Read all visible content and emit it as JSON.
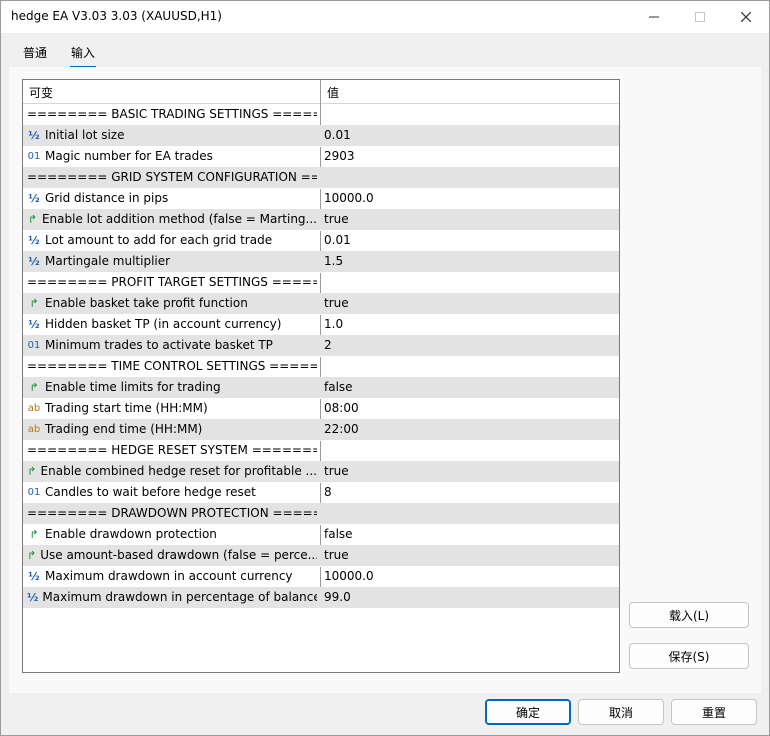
{
  "window": {
    "title": "hedge EA V3.03 3.03 (XAUUSD,H1)"
  },
  "tabs": [
    {
      "label": "普通"
    },
    {
      "label": "输入"
    }
  ],
  "grid": {
    "headers": {
      "variable": "可变",
      "value": "值"
    },
    "rows": [
      {
        "type": "section",
        "name": "======== BASIC TRADING SETTINGS ========",
        "value": ""
      },
      {
        "type": "double",
        "icon": "double-icon",
        "name": "Initial lot size",
        "value": "0.01"
      },
      {
        "type": "int",
        "icon": "integer-icon",
        "name": "Magic number for EA trades",
        "value": "2903"
      },
      {
        "type": "section",
        "name": "======== GRID SYSTEM CONFIGURATION ==...",
        "value": ""
      },
      {
        "type": "double",
        "icon": "double-icon",
        "name": "Grid distance in pips",
        "value": "10000.0"
      },
      {
        "type": "bool",
        "icon": "boolean-icon",
        "name": "Enable lot addition method (false = Marting...",
        "value": "true"
      },
      {
        "type": "double",
        "icon": "double-icon",
        "name": "Lot amount to add for each grid trade",
        "value": "0.01"
      },
      {
        "type": "double",
        "icon": "double-icon",
        "name": "Martingale multiplier",
        "value": "1.5"
      },
      {
        "type": "section",
        "name": "======== PROFIT TARGET SETTINGS ========",
        "value": ""
      },
      {
        "type": "bool",
        "icon": "boolean-icon",
        "name": "Enable basket take profit function",
        "value": "true"
      },
      {
        "type": "double",
        "icon": "double-icon",
        "name": "Hidden basket TP  (in account currency)",
        "value": "1.0"
      },
      {
        "type": "int",
        "icon": "integer-icon",
        "name": "Minimum trades to activate basket TP",
        "value": "2"
      },
      {
        "type": "section",
        "name": "======== TIME CONTROL SETTINGS ========",
        "value": ""
      },
      {
        "type": "bool",
        "icon": "boolean-icon",
        "name": "Enable time limits for trading",
        "value": "false"
      },
      {
        "type": "string",
        "icon": "string-icon",
        "name": "Trading start time (HH:MM)",
        "value": "08:00"
      },
      {
        "type": "string",
        "icon": "string-icon",
        "name": "Trading end time (HH:MM)",
        "value": "22:00"
      },
      {
        "type": "section",
        "name": "======== HEDGE RESET SYSTEM ========",
        "value": ""
      },
      {
        "type": "bool",
        "icon": "boolean-icon",
        "name": "Enable combined hedge reset for profitable ...",
        "value": "true"
      },
      {
        "type": "int",
        "icon": "integer-icon",
        "name": "Candles to wait before hedge reset",
        "value": "8"
      },
      {
        "type": "section",
        "name": "======== DRAWDOWN PROTECTION ======...",
        "value": ""
      },
      {
        "type": "bool",
        "icon": "boolean-icon",
        "name": "Enable drawdown protection",
        "value": "false"
      },
      {
        "type": "bool",
        "icon": "boolean-icon",
        "name": "Use amount-based drawdown (false = perce...",
        "value": "true"
      },
      {
        "type": "double",
        "icon": "double-icon",
        "name": "Maximum drawdown in account currency",
        "value": "10000.0"
      },
      {
        "type": "double",
        "icon": "double-icon",
        "name": "Maximum drawdown in percentage of balance",
        "value": "99.0"
      }
    ]
  },
  "side_buttons": {
    "load": "载入(L)",
    "save": "保存(S)"
  },
  "footer_buttons": {
    "ok": "确定",
    "cancel": "取消",
    "reset": "重置"
  },
  "glyphs": {
    "double": "½",
    "int": "01",
    "string": "ab",
    "bool": "↱"
  },
  "colors": {
    "accent": "#0067c0",
    "row_shade": "#e3e3e3"
  }
}
